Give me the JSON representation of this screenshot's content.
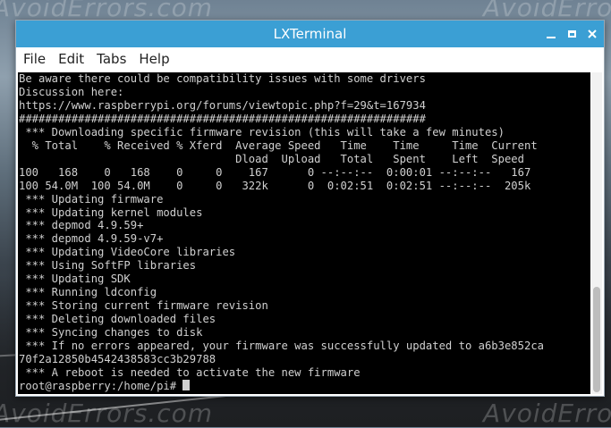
{
  "window": {
    "title": "LXTerminal"
  },
  "menubar": {
    "items": [
      "File",
      "Edit",
      "Tabs",
      "Help"
    ]
  },
  "watermark": {
    "text": "AvoidErrors.com"
  },
  "terminal": {
    "lines": [
      "Be aware there could be compatibility issues with some drivers",
      "Discussion here:",
      "https://www.raspberrypi.org/forums/viewtopic.php?f=29&t=167934",
      "##############################################################",
      " *** Downloading specific firmware revision (this will take a few minutes)",
      "  % Total    % Received % Xferd  Average Speed   Time    Time     Time  Current",
      "                                 Dload  Upload   Total   Spent    Left  Speed",
      "100   168    0   168    0     0    167      0 --:--:--  0:00:01 --:--:--   167",
      "100 54.0M  100 54.0M    0     0   322k      0  0:02:51  0:02:51 --:--:--  205k",
      " *** Updating firmware",
      " *** Updating kernel modules",
      " *** depmod 4.9.59+",
      " *** depmod 4.9.59-v7+",
      " *** Updating VideoCore libraries",
      " *** Using SoftFP libraries",
      " *** Updating SDK",
      " *** Running ldconfig",
      " *** Storing current firmware revision",
      " *** Deleting downloaded files",
      " *** Syncing changes to disk",
      " *** If no errors appeared, your firmware was successfully updated to a6b3e852ca",
      "70f2a12850b4542438583cc3b29788",
      " *** A reboot is needed to activate the new firmware"
    ],
    "prompt": "root@raspberry:/home/pi# "
  }
}
